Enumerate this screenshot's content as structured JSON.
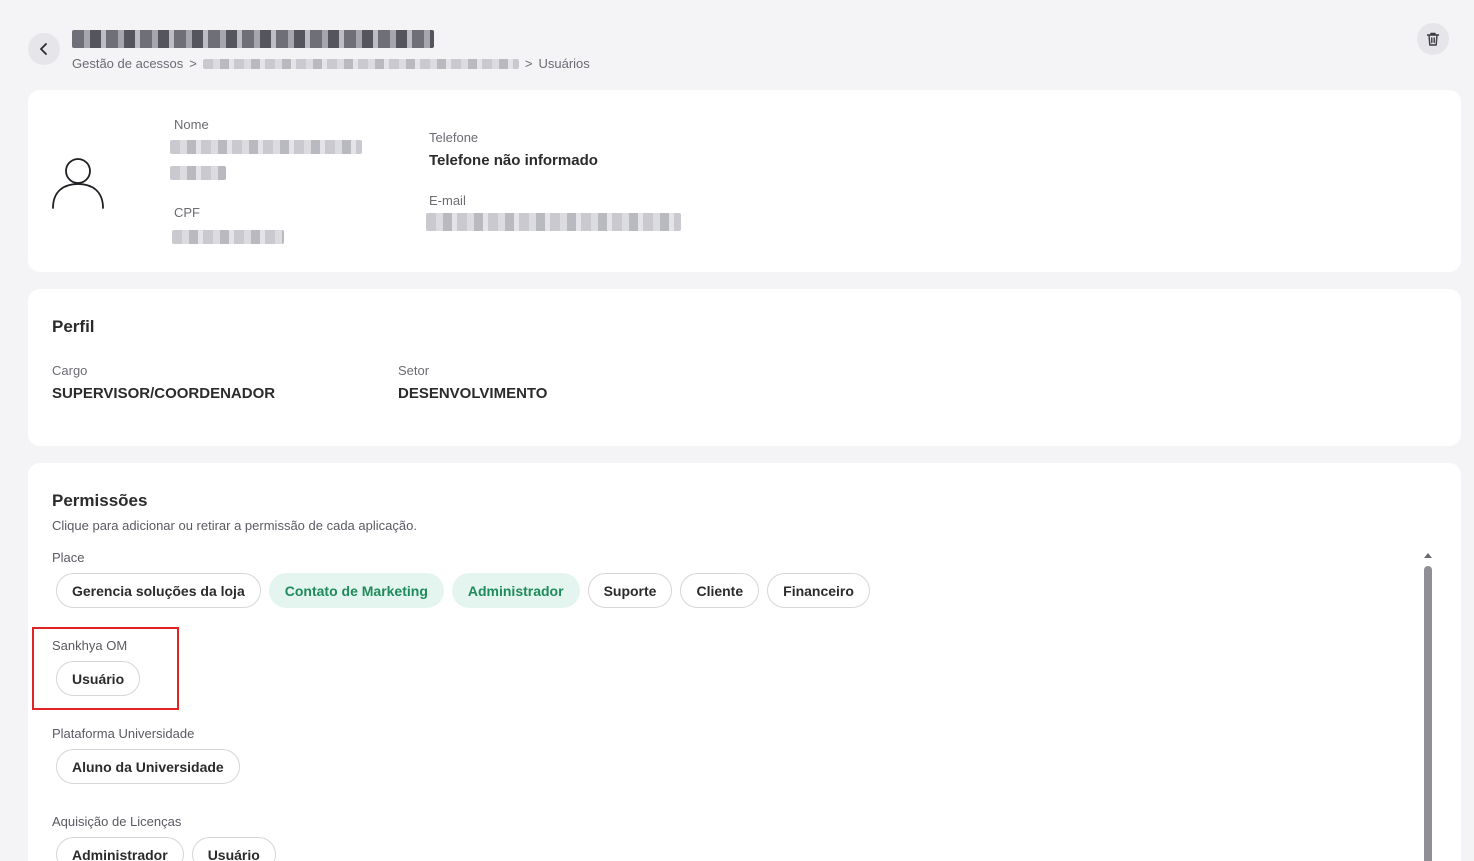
{
  "header": {
    "back_icon": "chevron-left-icon",
    "breadcrumb": {
      "root": "Gestão de acessos",
      "separator": ">",
      "current": "Usuários"
    },
    "delete_icon": "trash-icon"
  },
  "user": {
    "avatar_icon": "user-icon",
    "name_label": "Nome",
    "cpf_label": "CPF",
    "phone_label": "Telefone",
    "phone_value": "Telefone não informado",
    "email_label": "E-mail"
  },
  "perfil": {
    "title": "Perfil",
    "cargo_label": "Cargo",
    "cargo_value": "SUPERVISOR/COORDENADOR",
    "setor_label": "Setor",
    "setor_value": "DESENVOLVIMENTO"
  },
  "permissions": {
    "title": "Permissões",
    "subtitle": "Clique para adicionar ou retirar a permissão de cada aplicação.",
    "groups": [
      {
        "name": "Place",
        "roles": [
          {
            "label": "Gerencia soluções da loja",
            "active": false
          },
          {
            "label": "Contato de Marketing",
            "active": true
          },
          {
            "label": "Administrador",
            "active": true
          },
          {
            "label": "Suporte",
            "active": false
          },
          {
            "label": "Cliente",
            "active": false
          },
          {
            "label": "Financeiro",
            "active": false
          }
        ]
      },
      {
        "name": "Sankhya OM",
        "roles": [
          {
            "label": "Usuário",
            "active": false
          }
        ]
      },
      {
        "name": "Plataforma Universidade",
        "roles": [
          {
            "label": "Aluno da Universidade",
            "active": false
          }
        ]
      },
      {
        "name": "Aquisição de Licenças",
        "roles": [
          {
            "label": "Administrador",
            "active": false
          },
          {
            "label": "Usuário",
            "active": false
          }
        ]
      }
    ]
  },
  "colors": {
    "background": "#f4f4f6",
    "card": "#ffffff",
    "active_chip_bg": "#e3f5ee",
    "active_chip_text": "#1f8a5b",
    "highlight": "#e02424"
  }
}
